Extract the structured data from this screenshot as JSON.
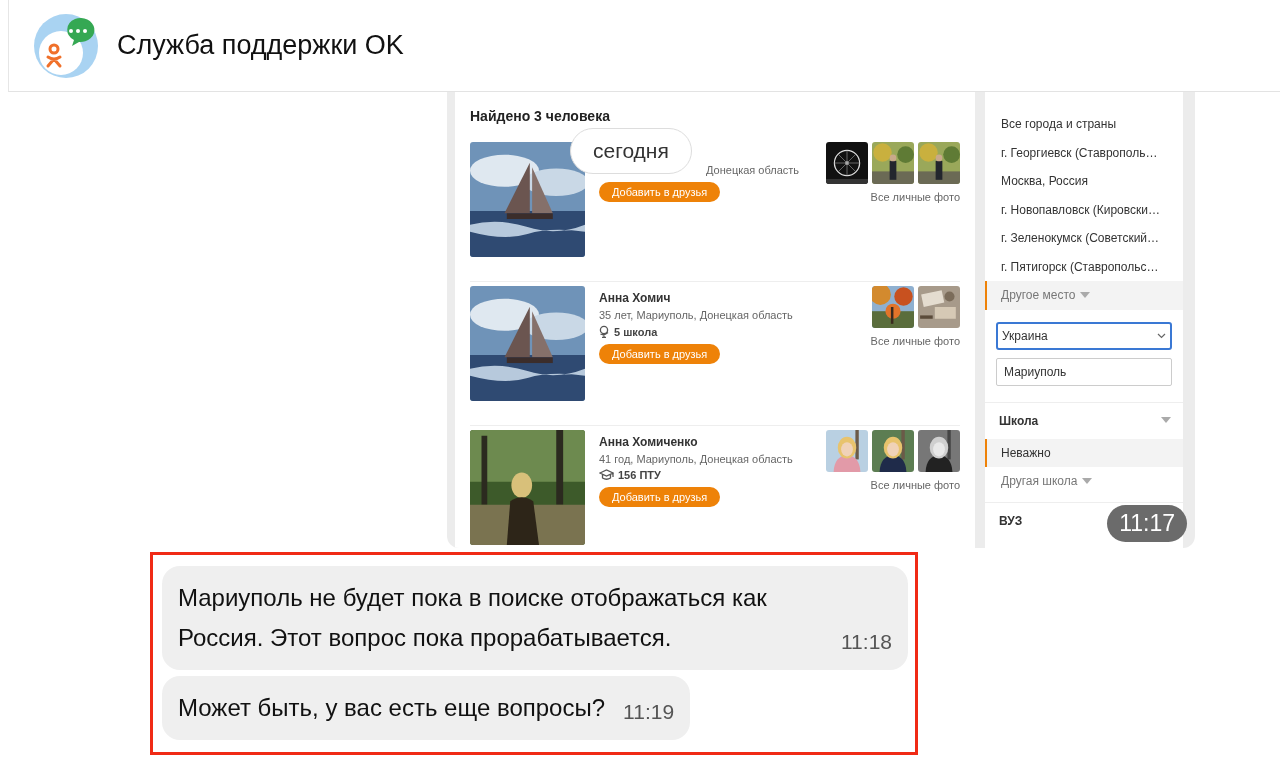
{
  "header": {
    "title": "Служба поддержки OK"
  },
  "date_divider": "сегодня",
  "shared_screenshot": {
    "heading": "Найдено 3 человека",
    "results": [
      {
        "info": "Донецкая область",
        "add_button": "Добавить в друзья",
        "all_photos": "Все личные фото"
      },
      {
        "name": "Анна Хомич",
        "info": "35 лет, Мариуполь, Донецкая область",
        "school": "5 школа",
        "kind": "school",
        "add_button": "Добавить в друзья",
        "all_photos": "Все личные фото"
      },
      {
        "name": "Анна Хомиченко",
        "info": "41 год, Мариуполь, Донецкая область",
        "school": "156 ПТУ",
        "kind": "college",
        "add_button": "Добавить в друзья",
        "all_photos": "Все личные фото"
      }
    ],
    "filters": {
      "places": [
        {
          "label": "Все города и страны",
          "selected": false,
          "kind": "option"
        },
        {
          "label": "г. Георгиевск (Ставрополь…",
          "selected": false,
          "kind": "option"
        },
        {
          "label": "Москва, Россия",
          "selected": false,
          "kind": "option"
        },
        {
          "label": "г. Новопавловск (Кировски…",
          "selected": false,
          "kind": "option"
        },
        {
          "label": "г. Зеленокумск (Советский…",
          "selected": false,
          "kind": "option"
        },
        {
          "label": "г. Пятигорск (Ставропольс…",
          "selected": false,
          "kind": "option"
        },
        {
          "label": "Другое место",
          "selected": true,
          "kind": "more"
        }
      ],
      "country_select": {
        "value": "Украина"
      },
      "city_field": {
        "value": "Мариуполь"
      },
      "school_title": "Школа",
      "school_options": [
        {
          "label": "Неважно",
          "selected": true,
          "kind": "option"
        },
        {
          "label": "Другая школа",
          "selected": false,
          "kind": "more"
        }
      ],
      "university_title": "ВУЗ"
    },
    "time": "11:17"
  },
  "messages": [
    {
      "text": "Мариуполь не будет пока в поиске отображаться как Россия. Этот вопрос пока прорабатывается.",
      "time": "11:18"
    },
    {
      "text": "Может быть, у вас есть еще вопросы?",
      "time": "11:19"
    }
  ]
}
